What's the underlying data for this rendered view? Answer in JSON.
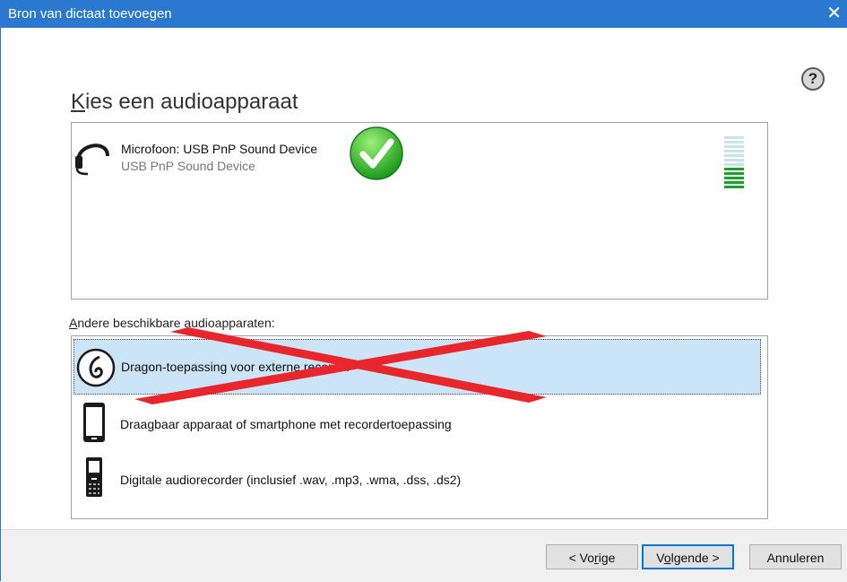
{
  "window": {
    "title": "Bron van dictaat toevoegen",
    "close_glyph": "✕"
  },
  "help": {
    "glyph": "?",
    "icon": "help-icon"
  },
  "heading": {
    "access_key": "K",
    "rest": "ies een audioapparaat"
  },
  "active_device": {
    "name": "Microfoon: USB PnP Sound Device",
    "subtitle": "USB PnP Sound Device",
    "status_icon": "check-icon",
    "level_meter": {
      "total_segments": 12,
      "lit_segments": 5,
      "lit_color": "#1e9e2a",
      "unlit_color": "#c9e3ea"
    }
  },
  "other_devices": {
    "label_access_key": "A",
    "label_rest": "ndere beschikbare audioapparaten:",
    "items": [
      {
        "label": "Dragon-toepassing voor externe recorder",
        "icon": "dragon-icon",
        "selected": true,
        "crossed_out": true
      },
      {
        "label": "Draagbaar apparaat of smartphone met recordertoepassing",
        "icon": "smartphone-icon",
        "selected": false
      },
      {
        "label": "Digitale audiorecorder (inclusief .wav, .mp3, .wma, .dss, .ds2)",
        "icon": "recorder-icon",
        "selected": false
      }
    ]
  },
  "buttons": {
    "back": {
      "before": "< Vo",
      "key": "r",
      "after": "ige"
    },
    "next": {
      "before": "V",
      "key": "o",
      "after": "lgende >"
    },
    "cancel": {
      "label": "Annuleren"
    }
  },
  "colors": {
    "titlebar": "#2a78cf",
    "selection": "#cce4f7",
    "cross": "#e8262b",
    "accent": "#0078d7"
  }
}
